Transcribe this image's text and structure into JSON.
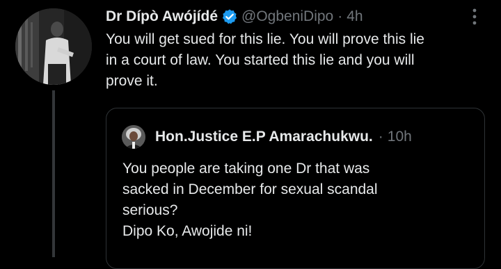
{
  "tweet": {
    "author_name": "Dr Dípò Awójídé",
    "verified_icon": "verified-badge-icon",
    "handle": "@OgbeniDipo",
    "separator": "·",
    "time": "4h",
    "more_icon": "more-options-icon",
    "text_lines": [
      "You will get sued for this lie. You will prove this lie",
      "in a court of law. You started this lie and you will",
      "prove it."
    ]
  },
  "quote": {
    "author_name": "Hon.Justice E.P Amarachukwu.",
    "separator": "·",
    "time": "10h",
    "text_lines": [
      "You people are taking one Dr that was",
      "sacked in December for sexual scandal",
      "serious?",
      "Dipo Ko, Awojide ni!"
    ]
  },
  "colors": {
    "background": "#000000",
    "primary_text": "#e7e9ea",
    "secondary_text": "#71767b",
    "verified_blue": "#1d9bf0",
    "border": "#2f3336",
    "thread_line": "#333639"
  }
}
